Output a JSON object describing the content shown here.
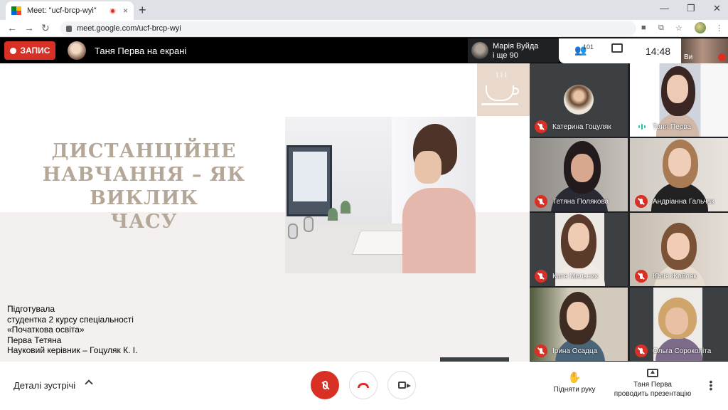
{
  "browser": {
    "tab_title": "Meet: \"ucf-brcp-wyi\"",
    "tab_close": "×",
    "new_tab": "+",
    "url": "meet.google.com/ucf-brcp-wyi",
    "back": "←",
    "forward": "→",
    "reload": "↻",
    "minimize": "—",
    "maximize": "❐",
    "close": "✕"
  },
  "topbar": {
    "record_label": "ЗАПИС",
    "presenter_text": "Таня Перва на екрані",
    "joiner_name": "Марія Вуйда",
    "joiner_more": "і ще 90",
    "people_count": "101",
    "time": "14:48",
    "self_label": "Ви"
  },
  "slide": {
    "title_lines": [
      "ДИСТАНЦІЙНЕ",
      "НАВЧАННЯ – ЯК ВИКЛИК",
      "ЧАСУ"
    ],
    "credits": [
      "Підготувала",
      "студентка 2 курсу спеціальності",
      "«Початкова освіта»",
      "Перва Тетяна",
      "Науковий керівник – Гоцуляк К. І."
    ]
  },
  "participants": [
    {
      "name": "Катерина Гоцуляк",
      "muted": true,
      "speaking": false,
      "avatar": true,
      "bg": "#3c4043"
    },
    {
      "name": "Таня Перва",
      "muted": false,
      "speaking": true,
      "avatar": false,
      "bg": "#cfd3dc"
    },
    {
      "name": "Тетяна Полякова",
      "muted": true,
      "speaking": false,
      "avatar": false,
      "bg": "#a8a29c"
    },
    {
      "name": "Андріанна Гальчак",
      "muted": true,
      "speaking": false,
      "avatar": false,
      "bg": "#d9d3cc"
    },
    {
      "name": "Катя Мельник",
      "muted": true,
      "speaking": false,
      "avatar": false,
      "bg": "#e6e3df"
    },
    {
      "name": "Юлія Жабляк",
      "muted": true,
      "speaking": false,
      "avatar": false,
      "bg": "#d6cfc5"
    },
    {
      "name": "Ірина Осадца",
      "muted": true,
      "speaking": false,
      "avatar": false,
      "bg": "#c9c3b6"
    },
    {
      "name": "Ольга Сороколіта",
      "muted": true,
      "speaking": false,
      "avatar": false,
      "bg": "#e4e4e2"
    }
  ],
  "bottombar": {
    "details_label": "Деталі зустрічі",
    "raise_hand_label": "Підняти руку",
    "presenting_line1": "Таня Перва",
    "presenting_line2": "проводить презентацію"
  },
  "colors": {
    "record": "#d93025",
    "title": "#b5a798",
    "speaking": "#1ec5a8"
  }
}
